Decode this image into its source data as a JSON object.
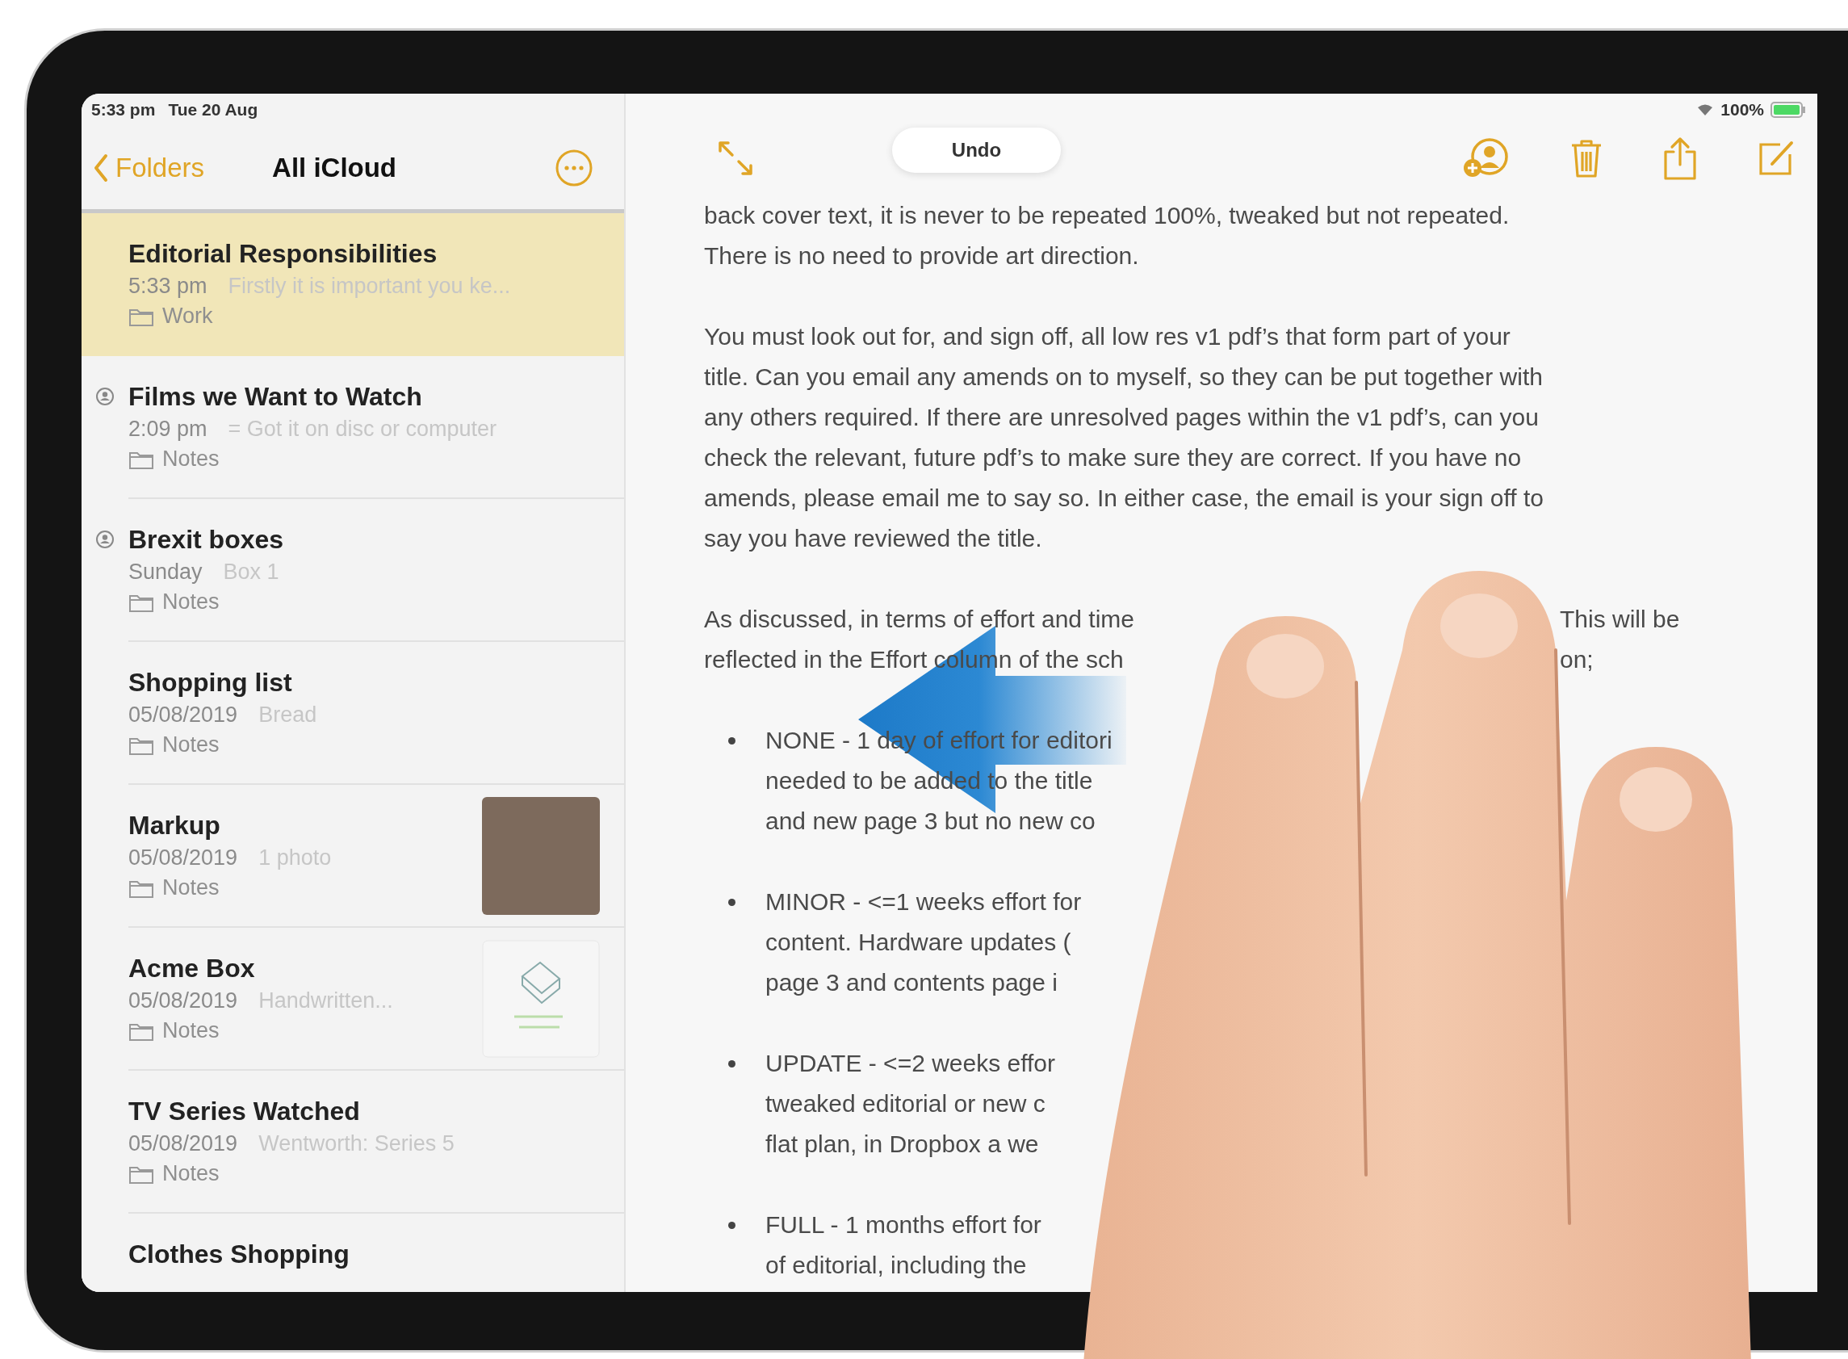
{
  "status_bar": {
    "time": "5:33 pm",
    "date": "Tue 20 Aug",
    "battery": "100%"
  },
  "sidebar": {
    "back": "Folders",
    "title": "All iCloud",
    "notes": [
      {
        "title": "Editorial Responsibilities",
        "date": "5:33 pm",
        "snippet": "Firstly it is important you ke...",
        "folder": "Work",
        "selected": true,
        "shared": false
      },
      {
        "title": "Films we Want to Watch",
        "date": "2:09 pm",
        "snippet": "= Got it on disc or computer",
        "folder": "Notes",
        "selected": false,
        "shared": true
      },
      {
        "title": "Brexit boxes",
        "date": "Sunday",
        "snippet": "Box 1",
        "folder": "Notes",
        "selected": false,
        "shared": true
      },
      {
        "title": "Shopping list",
        "date": "05/08/2019",
        "snippet": "Bread",
        "folder": "Notes",
        "selected": false,
        "shared": false
      },
      {
        "title": "Markup",
        "date": "05/08/2019",
        "snippet": "1 photo",
        "folder": "Notes",
        "selected": false,
        "shared": false,
        "kind": "photo"
      },
      {
        "title": "Acme Box",
        "date": "05/08/2019",
        "snippet": "Handwritten...",
        "folder": "Notes",
        "selected": false,
        "shared": false,
        "kind": "drawing"
      },
      {
        "title": "TV Series Watched",
        "date": "05/08/2019",
        "snippet": "Wentworth: Series 5",
        "folder": "Notes",
        "selected": false,
        "shared": false
      },
      {
        "title": "Clothes Shopping",
        "selected": false,
        "shared": false
      }
    ]
  },
  "note": {
    "undo": "Undo",
    "blocks": [
      {
        "kind": "paragraph",
        "lines": [
          {
            "text": "back cover text, it is never to be repeated 100%, tweaked but not repeated."
          },
          {
            "text": "There is no need to provide art direction."
          }
        ]
      },
      {
        "kind": "paragraph",
        "lines": [
          {
            "text": "You must look out for, and sign off, all low res v1 pdf’s that form part of your"
          },
          {
            "text": "title. Can you email any amends on to myself, so they can be put together with"
          },
          {
            "text": "any others required. If there are unresolved pages within the v1 pdf’s, can you"
          },
          {
            "text": "check the relevant, future pdf’s to make sure they are correct. If you have no"
          },
          {
            "text": "amends, please email me to say so. In either case, the email is your sign off to"
          },
          {
            "text": "say you have reviewed the title."
          }
        ]
      },
      {
        "kind": "paragraph",
        "lines": [
          {
            "text": "As discussed, in terms of effort and time",
            "right": "This will be"
          },
          {
            "text": "reflected in the Effort column of the sch",
            "right": "on;"
          }
        ]
      },
      {
        "kind": "bullet",
        "lines": [
          {
            "text": "NONE - 1 day of effort for editori"
          },
          {
            "text": "needed to be added to the title"
          },
          {
            "text": "and new page 3 but no new co"
          }
        ]
      },
      {
        "kind": "bullet",
        "lines": [
          {
            "text": "MINOR - <=1 weeks effort for"
          },
          {
            "text": "content. Hardware updates ("
          },
          {
            "text": "page 3 and contents page i"
          }
        ]
      },
      {
        "kind": "bullet",
        "lines": [
          {
            "text": "UPDATE - <=2 weeks effor"
          },
          {
            "text": "tweaked editorial or new c"
          },
          {
            "text": "flat plan, in Dropbox a we"
          }
        ]
      },
      {
        "kind": "bullet",
        "lines": [
          {
            "text": "FULL - 1 months effort for"
          },
          {
            "text": "of editorial, including the"
          }
        ]
      }
    ]
  }
}
